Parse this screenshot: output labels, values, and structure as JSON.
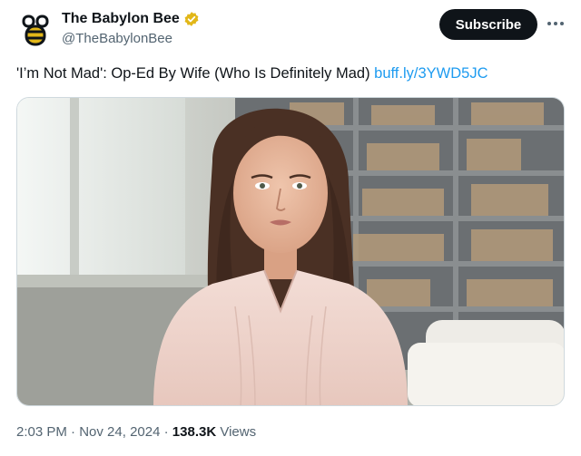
{
  "account": {
    "display_name": "The Babylon Bee",
    "handle": "@TheBabylonBee",
    "avatar_icon": "bee-logo-icon",
    "verified_icon": "verified-badge-icon",
    "verified_color": "#e2b719"
  },
  "actions": {
    "subscribe_label": "Subscribe",
    "more_icon": "more-options-icon"
  },
  "tweet": {
    "text": "'I’m Not Mad': Op-Ed By Wife (Who Is Definitely Mad)",
    "link": "buff.ly/3YWD5JC",
    "link_color": "#1d9bf0"
  },
  "media": {
    "type": "photo",
    "subject": "woman-at-desk-photo"
  },
  "meta": {
    "time": "2:03 PM",
    "separator": "·",
    "date": "Nov 24, 2024",
    "views_count": "138.3K",
    "views_label": "Views"
  },
  "colors": {
    "text_primary": "#0f1419",
    "text_secondary": "#536471",
    "button_bg": "#0f1419"
  }
}
